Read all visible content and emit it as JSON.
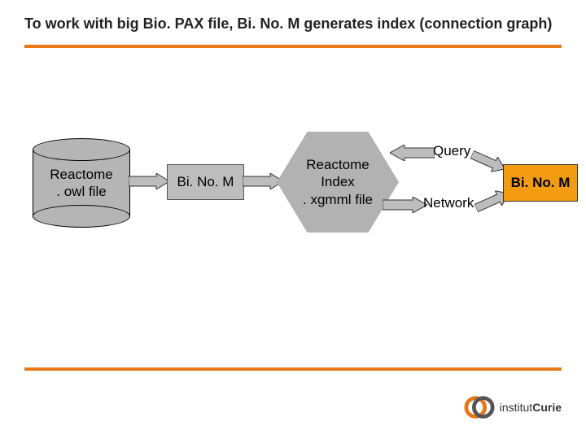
{
  "title": "To work with big Bio. PAX file, Bi. No. M generates index (connection graph)",
  "diagram": {
    "cylinder": {
      "line1": "Reactome",
      "line2": ". owl file"
    },
    "process1": "Bi. No. M",
    "hexagon": {
      "line1": "Reactome",
      "line2": "Index",
      "line3": ". xgmml file"
    },
    "query_label": "Query",
    "network_label": "Network",
    "process2": "Bi. No. M"
  },
  "footer": {
    "org_prefix": "institut",
    "org_name": "Curie"
  },
  "colors": {
    "accent": "#e67817",
    "grey": "#b5b5b5",
    "orange_box": "#f39c12"
  }
}
